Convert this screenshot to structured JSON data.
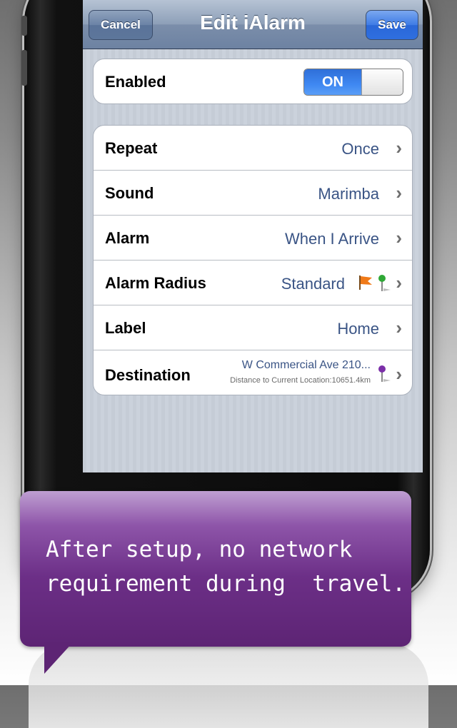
{
  "navbar": {
    "title": "Edit iAlarm",
    "cancel_label": "Cancel",
    "save_label": "Save"
  },
  "enabled_row": {
    "label": "Enabled",
    "toggle_text": "ON",
    "toggle_state": true
  },
  "settings": [
    {
      "label": "Repeat",
      "value": "Once",
      "icon": "chevron-right-icon"
    },
    {
      "label": "Sound",
      "value": "Marimba",
      "icon": "chevron-right-icon"
    },
    {
      "label": "Alarm",
      "value": "When I Arrive",
      "icon": "chevron-right-icon"
    },
    {
      "label": "Alarm Radius",
      "value": "Standard",
      "icon": "flag-icon"
    },
    {
      "label": "Label",
      "value": "Home",
      "icon": "chevron-right-icon"
    },
    {
      "label": "Destination",
      "value": "W Commercial Ave 210...",
      "detail": "Distance to Current Location:10651.4km",
      "icon": "map-pin-icon"
    }
  ],
  "callout": {
    "line1": "After setup, no network",
    "line2": "requirement during  travel."
  },
  "colors": {
    "value_text": "#3a5485",
    "toggle_on": "#3f88f2",
    "bubble": "#6c2f87",
    "navbar": "#8d9fb8"
  }
}
